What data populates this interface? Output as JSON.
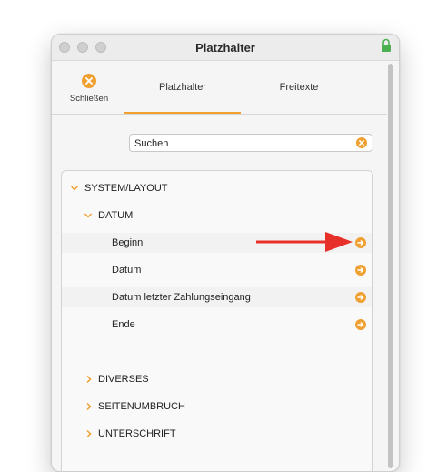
{
  "window": {
    "title": "Platzhalter"
  },
  "toolbar": {
    "close_label": "Schließen",
    "tabs": [
      {
        "label": "Platzhalter",
        "active": true
      },
      {
        "label": "Freitexte",
        "active": false
      }
    ]
  },
  "search": {
    "value": "",
    "placeholder": "Suchen"
  },
  "tree": {
    "groups": [
      {
        "label": "SYSTEM/LAYOUT",
        "expanded": true,
        "children": [
          {
            "label": "DATUM",
            "expanded": true,
            "items": [
              {
                "label": "Beginn"
              },
              {
                "label": "Datum"
              },
              {
                "label": "Datum letzter Zahlungseingang"
              },
              {
                "label": "Ende"
              }
            ]
          }
        ]
      },
      {
        "label": "DIVERSES",
        "expanded": false
      },
      {
        "label": "SEITENUMBRUCH",
        "expanded": false
      },
      {
        "label": "UNTERSCHRIFT",
        "expanded": false
      }
    ]
  },
  "colors": {
    "accent": "#f0a030",
    "annotation_arrow": "#e8302a",
    "lock": "#4caf50"
  },
  "icons": {
    "close": "close-circle-icon",
    "clear": "clear-circle-icon",
    "insert": "arrow-right-circle-icon",
    "expanded": "chevron-down-icon",
    "collapsed": "chevron-right-icon",
    "lock": "lock-icon"
  }
}
